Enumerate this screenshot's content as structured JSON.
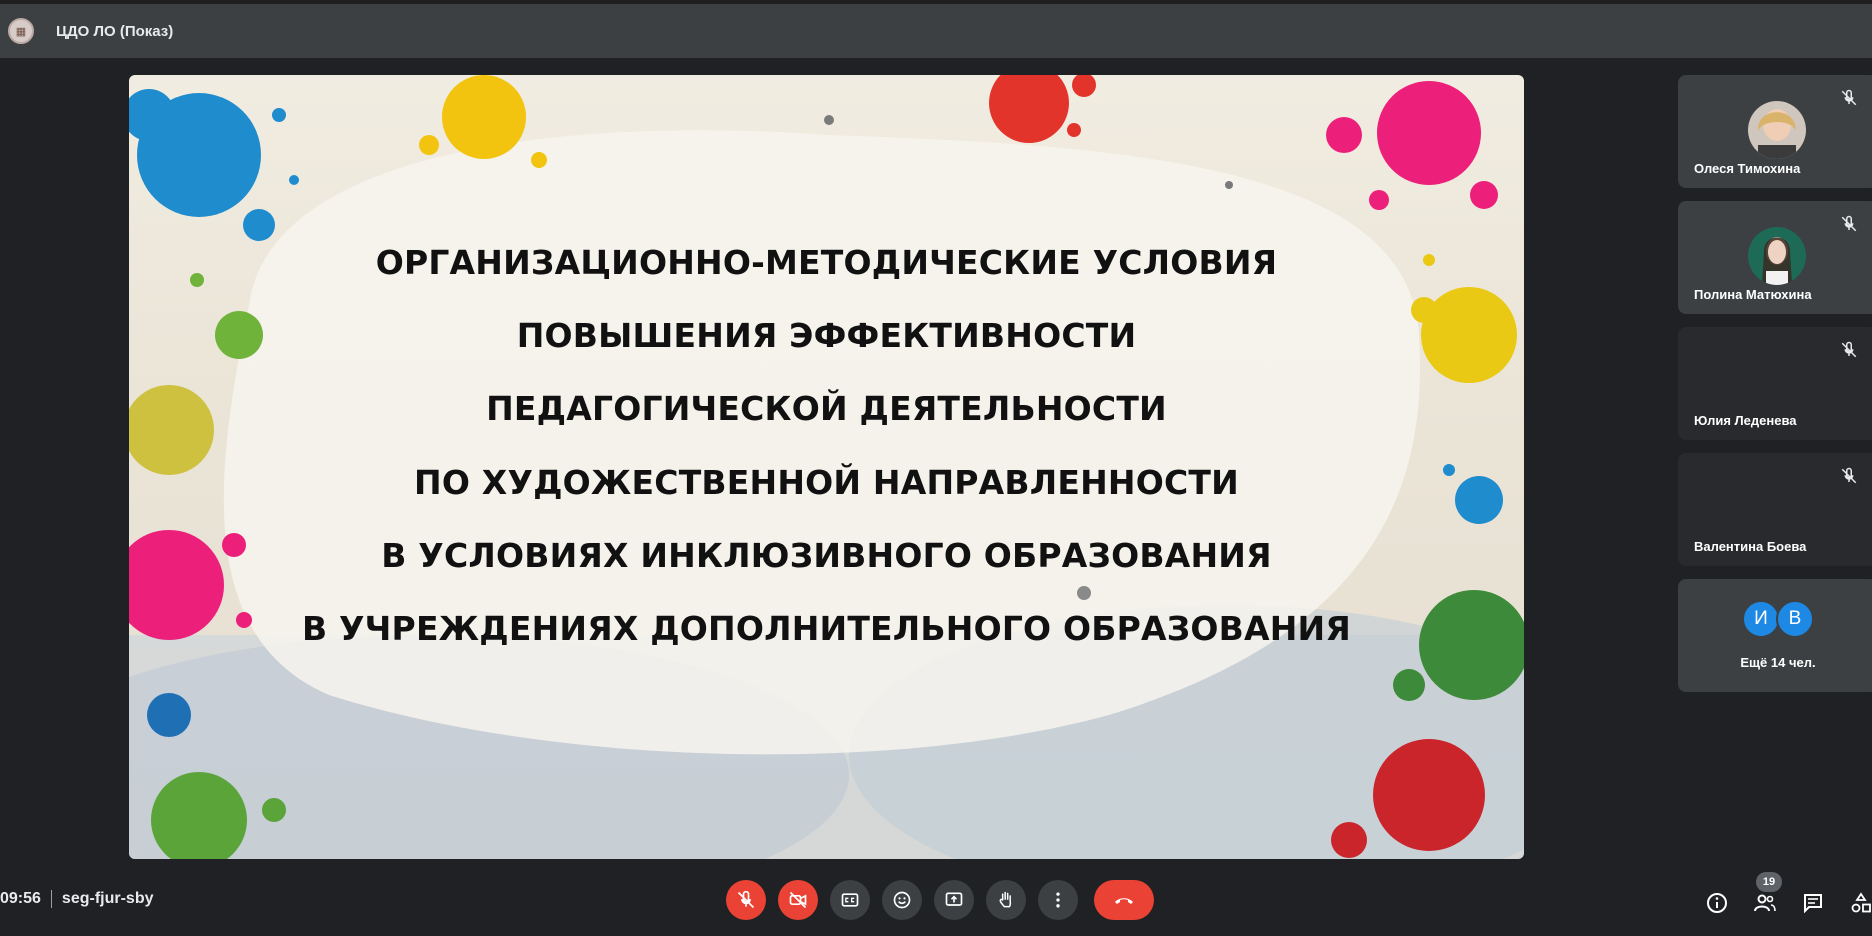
{
  "topbar": {
    "title": "ЦДО ЛО (Показ)"
  },
  "slide": {
    "lines": [
      "ОРГАНИЗАЦИОННО-МЕТОДИЧЕСКИЕ УСЛОВИЯ",
      "ПОВЫШЕНИЯ ЭФФЕКТИВНОСТИ",
      "ПЕДАГОГИЧЕСКОЙ ДЕЯТЕЛЬНОСТИ",
      "ПО ХУДОЖЕСТВЕННОЙ НАПРАВЛЕННОСТИ",
      "В УСЛОВИЯХ ИНКЛЮЗИВНОГО ОБРАЗОВАНИЯ",
      "В УЧРЕЖДЕНИЯХ ДОПОЛНИТЕЛЬНОГО ОБРАЗОВАНИЯ"
    ]
  },
  "participants": [
    {
      "name": "Олеся Тимохина",
      "muted": true,
      "has_video": true
    },
    {
      "name": "Полина Матюхина",
      "muted": true,
      "has_video": true
    },
    {
      "name": "Юлия Леденева",
      "muted": true,
      "has_video": false
    },
    {
      "name": "Валентина Боева",
      "muted": true,
      "has_video": false
    }
  ],
  "more": {
    "avatars": [
      "И",
      "В"
    ],
    "label": "Ещё 14 чел."
  },
  "meeting": {
    "time": "09:56",
    "code": "seg-fjur-sby"
  },
  "people_count": "19",
  "colors": {
    "danger": "#ea4335",
    "control_bg": "#3c4043",
    "background": "#202124",
    "avatar_blue": "#1e88e5"
  },
  "icons": {
    "controls": [
      "mic-off-icon",
      "camera-off-icon",
      "captions-icon",
      "emoji-icon",
      "present-icon",
      "raise-hand-icon",
      "more-options-icon",
      "end-call-icon"
    ],
    "right": [
      "info-icon",
      "people-icon",
      "chat-icon",
      "activities-icon"
    ]
  }
}
